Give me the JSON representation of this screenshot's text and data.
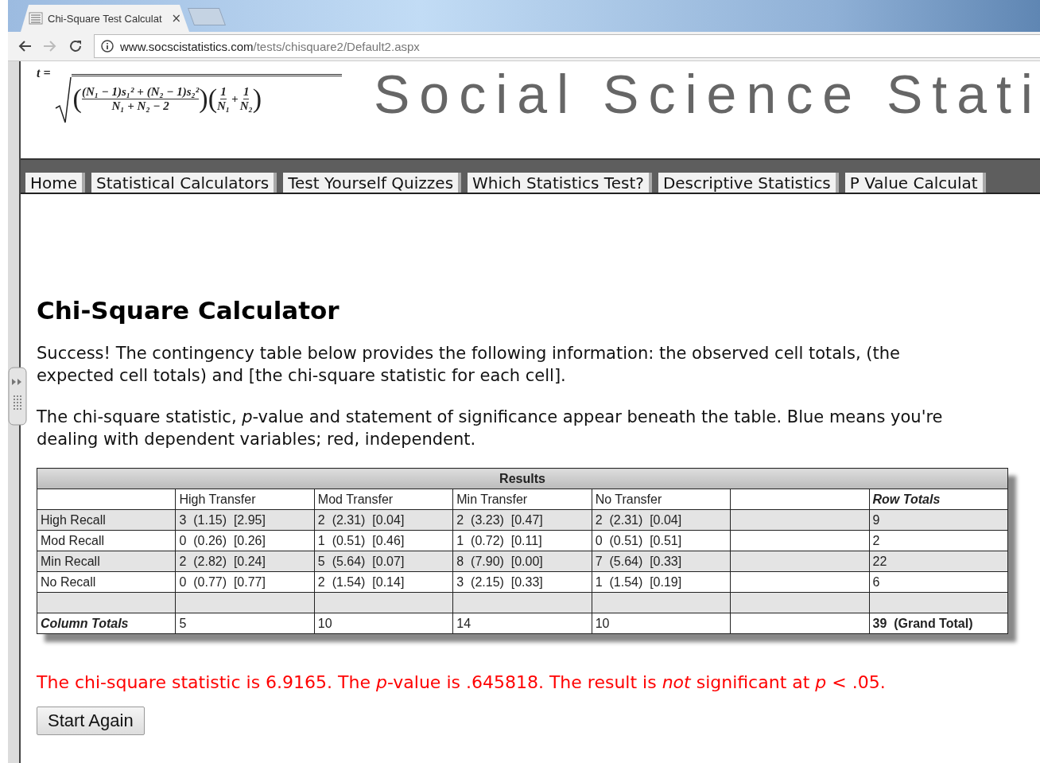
{
  "browser": {
    "tab_title": "Chi-Square Test Calculat",
    "tab_close": "×",
    "url_host": "www.socscistatistics.com",
    "url_path": "/tests/chisquare2/Default2.aspx"
  },
  "header": {
    "formula": {
      "lhs": "t =",
      "open_paren": "(",
      "inner_numerator": "(N₁ − 1)s₁² + (N₂ − 1)s₂²",
      "inner_denominator": "N₁ + N₂ − 2",
      "mid_parens": ")(",
      "one_a": "1",
      "n_a": "N₁",
      "plus": "+",
      "one_b": "1",
      "n_b": "N₂",
      "close_paren": ")"
    },
    "site_title": "Social Science Stati"
  },
  "nav": [
    "Home",
    "Statistical Calculators",
    "Test Yourself Quizzes",
    "Which Statistics Test?",
    "Descriptive Statistics",
    "P Value Calculat"
  ],
  "heading": "Chi-Square Calculator",
  "paragraphs": [
    "Success! The contingency table below provides the following information: the observed cell totals, (the expected cell totals) and [the chi-square statistic for each cell].",
    "The chi-square statistic, *p*-value and statement of significance appear beneath the table. Blue means you're dealing with dependent variables; red, independent."
  ],
  "table": {
    "title": "Results",
    "columns": [
      "High Transfer",
      "Mod Transfer",
      "Min Transfer",
      "No Transfer"
    ],
    "row_totals_header": "Row Totals",
    "rows": [
      {
        "label": "High Recall",
        "cells": [
          "3  (1.15)  [2.95]",
          "2  (2.31)  [0.04]",
          "2  (3.23)  [0.47]",
          "2  (2.31)  [0.04]"
        ],
        "total": "9"
      },
      {
        "label": "Mod Recall",
        "cells": [
          "0  (0.26)  [0.26]",
          "1  (0.51)  [0.46]",
          "1  (0.72)  [0.11]",
          "0  (0.51)  [0.51]"
        ],
        "total": "2"
      },
      {
        "label": "Min Recall",
        "cells": [
          "2  (2.82)  [0.24]",
          "5  (5.64)  [0.07]",
          "8  (7.90)  [0.00]",
          "7  (5.64)  [0.33]"
        ],
        "total": "22"
      },
      {
        "label": "No Recall",
        "cells": [
          "0  (0.77)  [0.77]",
          "2  (1.54)  [0.14]",
          "3  (2.15)  [0.33]",
          "1  (1.54)  [0.19]"
        ],
        "total": "6"
      }
    ],
    "column_totals": {
      "label": "Column Totals",
      "cells": [
        "5",
        "10",
        "14",
        "10"
      ],
      "grand_total": "39  (Grand Total)"
    }
  },
  "result": "The chi-square statistic is 6.9165. The *p*-value is .645818. The result is *not* significant at *p* < .05.",
  "button": "Start Again"
}
